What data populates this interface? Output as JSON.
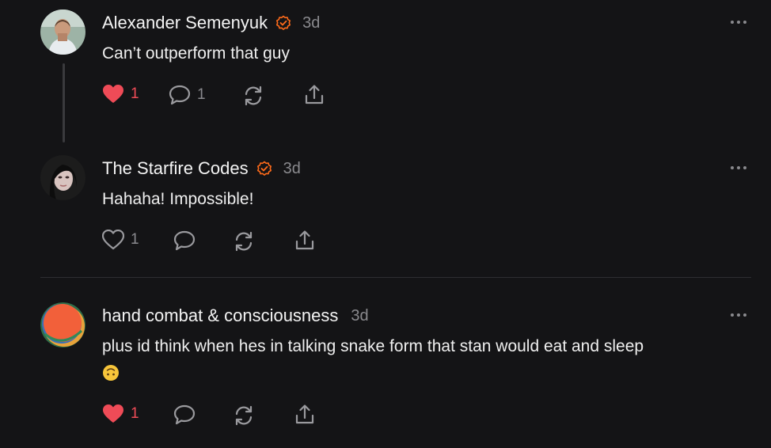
{
  "comments": [
    {
      "author": "Alexander Semenyuk",
      "verified": true,
      "time": "3d",
      "text": "Can’t outperform that guy",
      "likes": "1",
      "liked": true,
      "replies": "1"
    },
    {
      "author": "The Starfire Codes",
      "verified": true,
      "time": "3d",
      "text": "Hahaha! Impossible!",
      "likes": "1",
      "liked": false,
      "replies": ""
    },
    {
      "author": "hand combat & consciousness",
      "verified": false,
      "time": "3d",
      "text": "plus id think when hes in talking snake form that stan would eat and sleep",
      "emoji": "upside-down-face-emoji",
      "likes": "1",
      "liked": true,
      "replies": ""
    }
  ],
  "colors": {
    "background": "#141416",
    "like_active": "#ef4b57",
    "verified_badge": "#ff6b1a",
    "muted": "#8a8a8e"
  },
  "icons": [
    "heart-icon",
    "comment-bubble-icon",
    "restack-icon",
    "share-icon",
    "more-icon",
    "verified-badge-icon"
  ]
}
